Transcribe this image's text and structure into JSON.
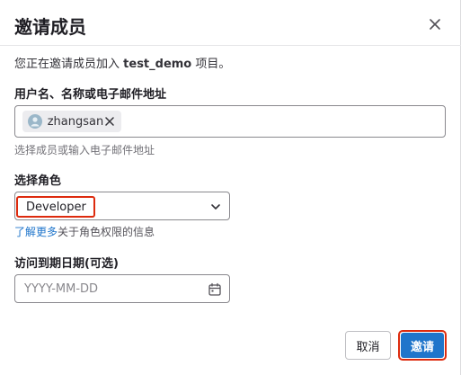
{
  "dialog": {
    "title": "邀请成员",
    "intro_prefix": "您正在邀请成员加入",
    "project_name": "test_demo",
    "intro_suffix": "项目。"
  },
  "members": {
    "label": "用户名、名称或电子邮件地址",
    "tokens": [
      {
        "name": "zhangsan"
      }
    ],
    "help_text": "选择成员或输入电子邮件地址"
  },
  "role": {
    "label": "选择角色",
    "selected": "Developer",
    "link_text": "了解更多",
    "link_suffix": "关于角色权限的信息"
  },
  "expiration": {
    "label": "访问到期日期(可选)",
    "placeholder": "YYYY-MM-DD"
  },
  "footer": {
    "cancel_label": "取消",
    "invite_label": "邀请"
  },
  "colors": {
    "primary": "#1f75cb",
    "highlight": "#dd2b0e",
    "border": "#89888d"
  },
  "icons": {
    "close": "close-icon",
    "token_remove": "close-icon",
    "select_caret": "chevron-down-icon",
    "calendar": "calendar-icon",
    "avatar": "user-avatar"
  }
}
